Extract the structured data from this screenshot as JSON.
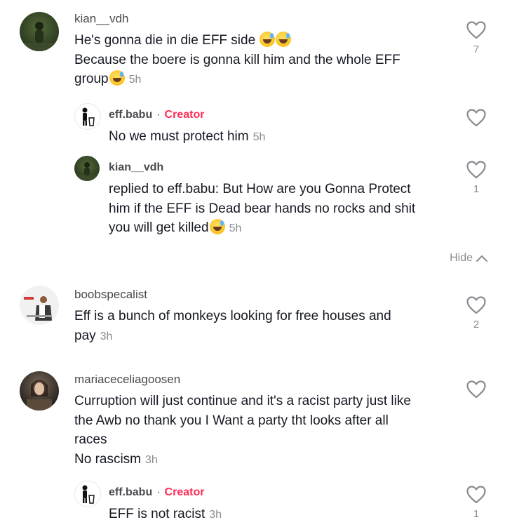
{
  "comments": [
    {
      "username": "kian__vdh",
      "lines": [
        "He's gonna die in die EFF side",
        "Because the boere is gonna kill him and the whole EFF",
        "group"
      ],
      "time": "5h",
      "likes": "7"
    },
    {
      "username": "eff.babu",
      "tag": "Creator",
      "text": "No we must protect him",
      "time": "5h",
      "likes": ""
    },
    {
      "username": "kian__vdh",
      "lines": [
        "replied to eff.babu: But How are you Gonna Protect",
        "him if the EFF is Dead bear hands no rocks and shit",
        "you will get killed"
      ],
      "time": "5h",
      "likes": "1"
    },
    {
      "username": "boobspecalist",
      "lines": [
        "Eff is a bunch of monkeys looking for free houses and",
        "pay"
      ],
      "time": "3h",
      "likes": "2"
    },
    {
      "username": "mariaceceliagoosen",
      "lines": [
        "Curruption will just continue and it's a racist party just like",
        "the Awb no thank you I Want a party tht looks after all",
        "races",
        "No rascism"
      ],
      "time": "3h",
      "likes": ""
    },
    {
      "username": "eff.babu",
      "tag": "Creator",
      "text": "EFF is not racist",
      "time": "3h",
      "likes": "1"
    }
  ],
  "hide_label": "Hide",
  "separator": "·",
  "icons": {
    "like": "heart-outline-icon",
    "hide": "chevron-up-icon"
  },
  "colors": {
    "creator": "#fe2c55",
    "secondary": "#8a8b91"
  }
}
